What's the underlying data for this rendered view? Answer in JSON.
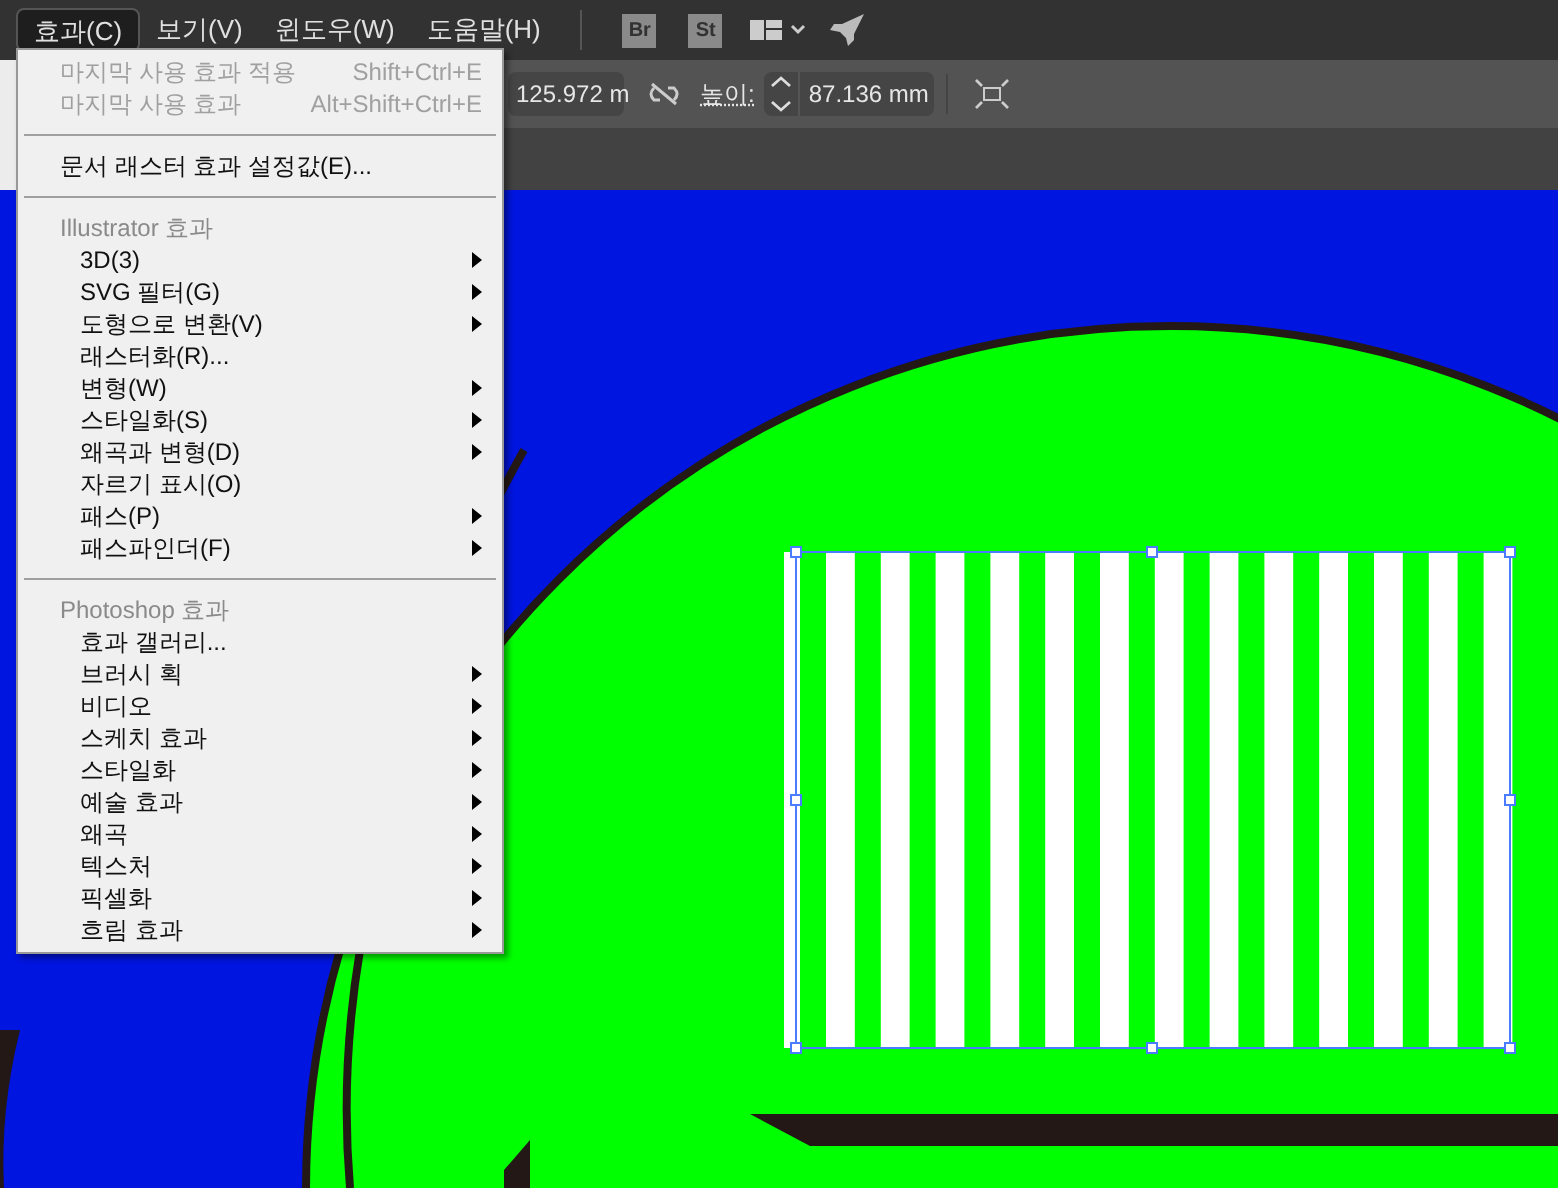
{
  "menu_bar": [
    {
      "label": "효과(C)",
      "selected": true
    },
    {
      "label": "보기(V)",
      "selected": false
    },
    {
      "label": "윈도우(W)",
      "selected": false
    },
    {
      "label": "도움말(H)",
      "selected": false
    }
  ],
  "app_buttons": [
    "Br",
    "St"
  ],
  "control_bar": {
    "width_value": "125.972 m",
    "height_label": "높이:",
    "height_value": "87.136 mm"
  },
  "menu": [
    {
      "kind": "item",
      "label": "마지막 사용 효과 적용",
      "shortcut": "Shift+Ctrl+E",
      "disabled": true,
      "submenu": false
    },
    {
      "kind": "item",
      "label": "마지막 사용 효과",
      "shortcut": "Alt+Shift+Ctrl+E",
      "disabled": true,
      "submenu": false
    },
    {
      "kind": "separator"
    },
    {
      "kind": "item",
      "label": "문서 래스터 효과 설정값(E)...",
      "disabled": false,
      "submenu": false
    },
    {
      "kind": "separator"
    },
    {
      "kind": "header",
      "label": "Illustrator 효과"
    },
    {
      "kind": "item",
      "label": "3D(3)",
      "disabled": false,
      "submenu": true
    },
    {
      "kind": "item",
      "label": "SVG 필터(G)",
      "disabled": false,
      "submenu": true
    },
    {
      "kind": "item",
      "label": "도형으로 변환(V)",
      "disabled": false,
      "submenu": true
    },
    {
      "kind": "item",
      "label": "래스터화(R)...",
      "disabled": false,
      "submenu": false
    },
    {
      "kind": "item",
      "label": "변형(W)",
      "disabled": false,
      "submenu": true
    },
    {
      "kind": "item",
      "label": "스타일화(S)",
      "disabled": false,
      "submenu": true
    },
    {
      "kind": "item",
      "label": "왜곡과 변형(D)",
      "disabled": false,
      "submenu": true
    },
    {
      "kind": "item",
      "label": "자르기 표시(O)",
      "disabled": false,
      "submenu": false
    },
    {
      "kind": "item",
      "label": "패스(P)",
      "disabled": false,
      "submenu": true
    },
    {
      "kind": "item",
      "label": "패스파인더(F)",
      "disabled": false,
      "submenu": true
    },
    {
      "kind": "separator"
    },
    {
      "kind": "header",
      "label": "Photoshop 효과"
    },
    {
      "kind": "item",
      "label": "효과 갤러리...",
      "disabled": false,
      "submenu": false
    },
    {
      "kind": "item",
      "label": "브러시 획",
      "disabled": false,
      "submenu": true
    },
    {
      "kind": "item",
      "label": "비디오",
      "disabled": false,
      "submenu": true
    },
    {
      "kind": "item",
      "label": "스케치 효과",
      "disabled": false,
      "submenu": true
    },
    {
      "kind": "item",
      "label": "스타일화",
      "disabled": false,
      "submenu": true
    },
    {
      "kind": "item",
      "label": "예술 효과",
      "disabled": false,
      "submenu": true
    },
    {
      "kind": "item",
      "label": "왜곡",
      "disabled": false,
      "submenu": true
    },
    {
      "kind": "item",
      "label": "텍스처",
      "disabled": false,
      "submenu": true
    },
    {
      "kind": "item",
      "label": "픽셀화",
      "disabled": false,
      "submenu": true
    },
    {
      "kind": "item",
      "label": "흐림 효과",
      "disabled": false,
      "submenu": true
    }
  ]
}
